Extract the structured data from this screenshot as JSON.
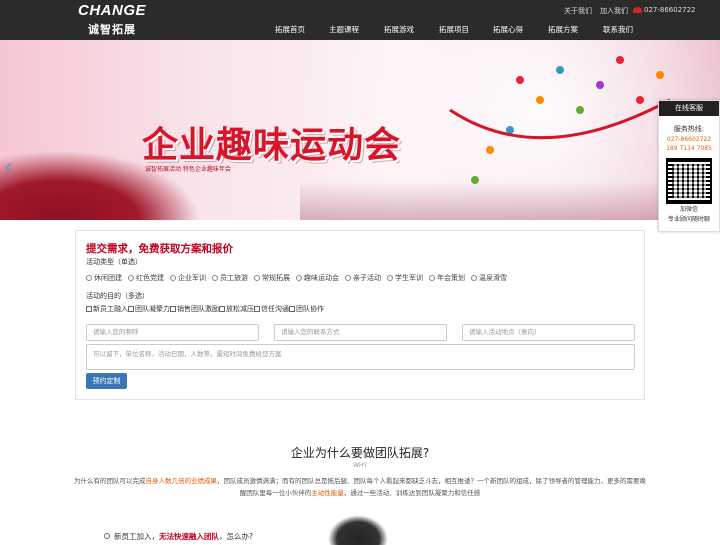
{
  "header": {
    "logo_en": "CHANGE",
    "logo_cn": "诚智拓展",
    "top_links": [
      "关于我们",
      "加入我们"
    ],
    "phone": "027-86602722",
    "nav": [
      "拓展首页",
      "主题课程",
      "拓展游戏",
      "拓展项目",
      "拓展心得",
      "拓展方案",
      "联系我们"
    ]
  },
  "banner": {
    "title": "企业趣味运动会",
    "subtitle": "诚智拓展活动  特色企业趣味年会"
  },
  "sidebar": {
    "head": "在线客服",
    "label": "服务热线:",
    "phone1": "027-86602722",
    "phone2": "189 7114 7085",
    "note1": "加微信",
    "note2": "专业顾问随时聊"
  },
  "form": {
    "title": "提交需求，免费获取方案和报价",
    "type_label": "活动类型（单选）",
    "types": [
      "休闲团建",
      "红色党建",
      "企业军训",
      "员工旅游",
      "常规拓展",
      "趣味运动会",
      "亲子活动",
      "学生军训",
      "年会策划",
      "温泉滑雪"
    ],
    "purpose_label": "活动的目的（多选）",
    "purposes": [
      "新员工融入",
      "团队凝聚力",
      "销售团队激励",
      "放松减压",
      "信任沟通",
      "团队协作"
    ],
    "name_placeholder": "请输入您的称呼",
    "contact_placeholder": "请输入您的联系方式",
    "place_placeholder": "请输入活动地点（意向）",
    "message_placeholder": "可以留下，单位名称，活动日期，人数等。最短时间免费给您方案",
    "submit": "预约定制"
  },
  "why": {
    "title": "企业为什么要做团队拓展?",
    "en": "WHY",
    "p1": "为什么有的团队可以完成",
    "h1": "自身人数几倍的业绩成果",
    "p2": "，团队成员激情满满；而有的团队总是拖后腿、团队每个人看起来都缺乏斗志，相互推诿？一个新团队的组成，除了领导者的管理能力，更多的需要唤醒团队里每一位小伙伴的",
    "h2": "主动性能量",
    "p3": "，通过一些活动、训练达到团队凝聚力和信任感"
  },
  "question": {
    "pre": "新员工加入，",
    "highlight": "无法快速融入团队",
    "post": "，怎么办?"
  }
}
